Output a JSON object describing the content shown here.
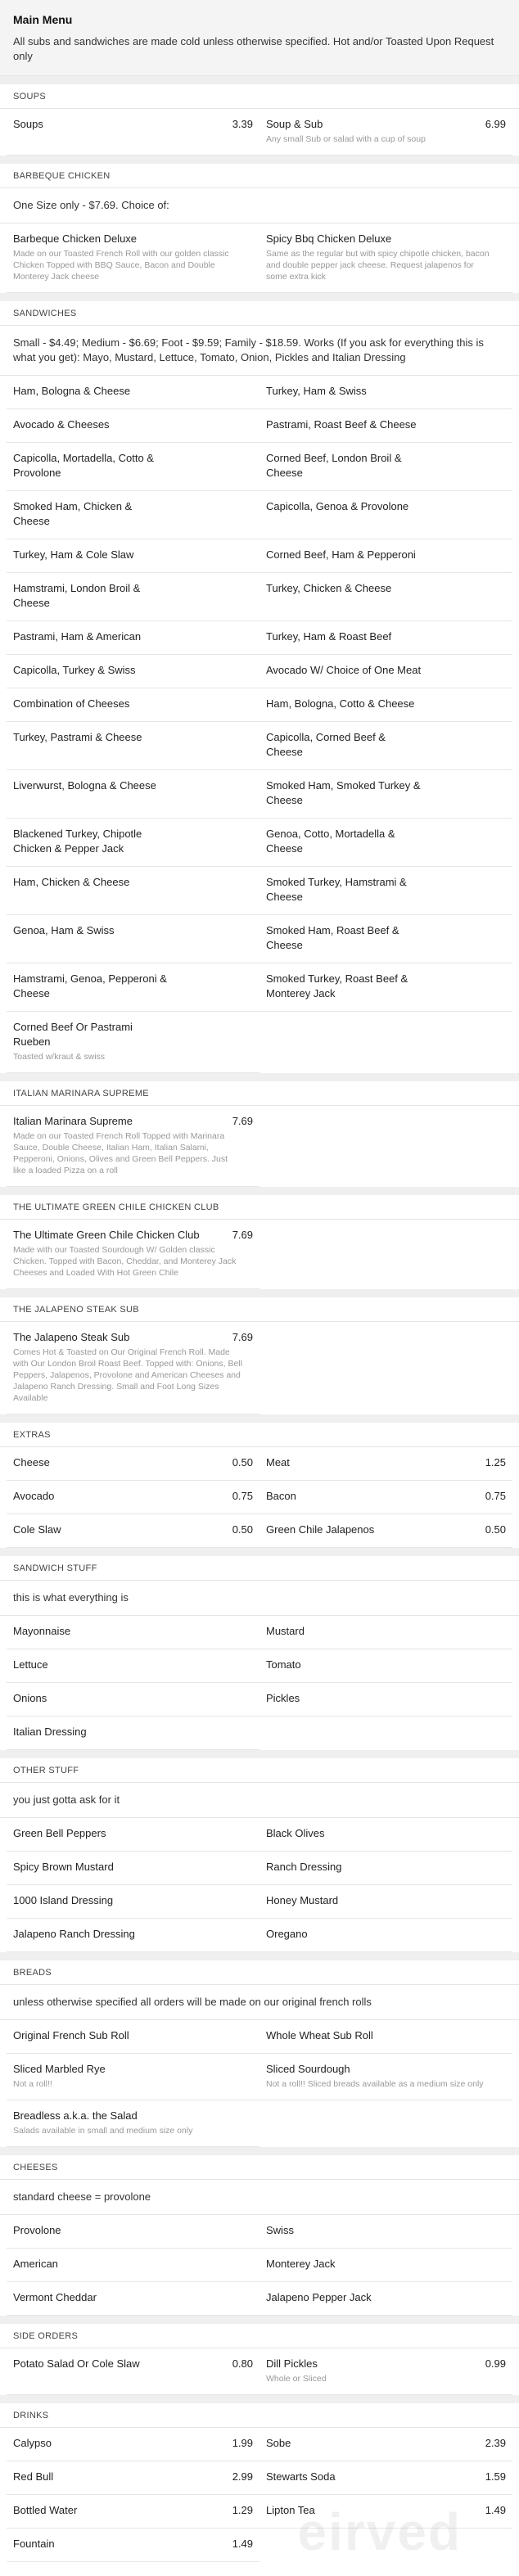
{
  "header": {
    "title": "Main Menu",
    "note": "All subs and sandwiches are made cold unless otherwise specified. Hot and/or Toasted Upon Request only"
  },
  "sections": [
    {
      "title": "SOUPS",
      "desc": "",
      "items": [
        {
          "name": "Soups",
          "price": "3.39",
          "desc": ""
        },
        {
          "name": "Soup & Sub",
          "price": "6.99",
          "desc": "Any small Sub or salad with a cup of soup"
        }
      ]
    },
    {
      "title": "BARBEQUE CHICKEN",
      "desc": "One Size only - $7.69. Choice of:",
      "items": [
        {
          "name": "Barbeque Chicken Deluxe",
          "price": "",
          "desc": "Made on our Toasted French Roll with our golden classic Chicken Topped with BBQ Sauce, Bacon and Double Monterey Jack cheese"
        },
        {
          "name": "Spicy Bbq Chicken Deluxe",
          "price": "",
          "desc": "Same as the regular but with spicy chipotle chicken, bacon and double pepper jack cheese. Request jalapenos for some extra kick"
        }
      ]
    },
    {
      "title": "SANDWICHES",
      "desc": "Small - $4.49; Medium - $6.69; Foot - $9.59; Family - $18.59. Works (If you ask for everything this is what you get): Mayo, Mustard, Lettuce, Tomato, Onion, Pickles and Italian Dressing",
      "items": [
        {
          "name": "Ham, Bologna & Cheese",
          "price": "",
          "desc": ""
        },
        {
          "name": "Turkey, Ham & Swiss",
          "price": "",
          "desc": ""
        },
        {
          "name": "Avocado & Cheeses",
          "price": "",
          "desc": ""
        },
        {
          "name": "Pastrami, Roast Beef & Cheese",
          "price": "",
          "desc": ""
        },
        {
          "name": "Capicolla, Mortadella, Cotto & Provolone",
          "price": "",
          "desc": ""
        },
        {
          "name": "Corned Beef, London Broil & Cheese",
          "price": "",
          "desc": ""
        },
        {
          "name": "Smoked Ham, Chicken & Cheese",
          "price": "",
          "desc": ""
        },
        {
          "name": "Capicolla, Genoa & Provolone",
          "price": "",
          "desc": ""
        },
        {
          "name": "Turkey, Ham & Cole Slaw",
          "price": "",
          "desc": ""
        },
        {
          "name": "Corned Beef, Ham & Pepperoni",
          "price": "",
          "desc": ""
        },
        {
          "name": "Hamstrami, London Broil & Cheese",
          "price": "",
          "desc": ""
        },
        {
          "name": "Turkey, Chicken & Cheese",
          "price": "",
          "desc": ""
        },
        {
          "name": "Pastrami, Ham & American",
          "price": "",
          "desc": ""
        },
        {
          "name": "Turkey, Ham & Roast Beef",
          "price": "",
          "desc": ""
        },
        {
          "name": "Capicolla, Turkey & Swiss",
          "price": "",
          "desc": ""
        },
        {
          "name": "Avocado W/ Choice of One Meat",
          "price": "",
          "desc": ""
        },
        {
          "name": "Combination of Cheeses",
          "price": "",
          "desc": ""
        },
        {
          "name": "Ham, Bologna, Cotto & Cheese",
          "price": "",
          "desc": ""
        },
        {
          "name": "Turkey, Pastrami & Cheese",
          "price": "",
          "desc": ""
        },
        {
          "name": "Capicolla, Corned Beef & Cheese",
          "price": "",
          "desc": ""
        },
        {
          "name": "Liverwurst, Bologna & Cheese",
          "price": "",
          "desc": ""
        },
        {
          "name": "Smoked Ham, Smoked Turkey & Cheese",
          "price": "",
          "desc": ""
        },
        {
          "name": "Blackened Turkey, Chipotle Chicken & Pepper Jack",
          "price": "",
          "desc": ""
        },
        {
          "name": "Genoa, Cotto, Mortadella & Cheese",
          "price": "",
          "desc": ""
        },
        {
          "name": "Ham, Chicken & Cheese",
          "price": "",
          "desc": ""
        },
        {
          "name": "Smoked Turkey, Hamstrami & Cheese",
          "price": "",
          "desc": ""
        },
        {
          "name": "Genoa, Ham & Swiss",
          "price": "",
          "desc": ""
        },
        {
          "name": "Smoked Ham, Roast Beef & Cheese",
          "price": "",
          "desc": ""
        },
        {
          "name": "Hamstrami, Genoa, Pepperoni & Cheese",
          "price": "",
          "desc": ""
        },
        {
          "name": "Smoked Turkey, Roast Beef & Monterey Jack",
          "price": "",
          "desc": ""
        },
        {
          "name": "Corned Beef Or Pastrami Rueben",
          "price": "",
          "desc": "Toasted w/kraut & swiss"
        }
      ]
    },
    {
      "title": "ITALIAN MARINARA SUPREME",
      "desc": "",
      "items": [
        {
          "name": "Italian Marinara Supreme",
          "price": "7.69",
          "desc": "Made on our Toasted French Roll Topped with Marinara Sauce, Double Cheese, Italian Ham, Italian Salami, Pepperoni, Onions, Olives and Green Bell Peppers. Just like a loaded Pizza on a roll"
        }
      ]
    },
    {
      "title": "THE ULTIMATE GREEN CHILE CHICKEN CLUB",
      "desc": "",
      "items": [
        {
          "name": "The Ultimate Green Chile Chicken Club",
          "price": "7.69",
          "desc": "Made with our Toasted Sourdough W/ Golden classic Chicken. Topped with Bacon, Cheddar, and Monterey Jack Cheeses and Loaded With Hot Green Chile"
        }
      ]
    },
    {
      "title": "THE JALAPENO STEAK SUB",
      "desc": "",
      "items": [
        {
          "name": "The Jalapeno Steak Sub",
          "price": "7.69",
          "desc": "Comes Hot & Toasted on Our Original French Roll. Made with Our London Broil Roast Beef. Topped with: Onions, Bell Peppers, Jalapenos, Provolone and American Cheeses and Jalapeno Ranch Dressing. Small and Foot Long Sizes Available"
        }
      ]
    },
    {
      "title": "EXTRAS",
      "desc": "",
      "items": [
        {
          "name": "Cheese",
          "price": "0.50",
          "desc": ""
        },
        {
          "name": "Meat",
          "price": "1.25",
          "desc": ""
        },
        {
          "name": "Avocado",
          "price": "0.75",
          "desc": ""
        },
        {
          "name": "Bacon",
          "price": "0.75",
          "desc": ""
        },
        {
          "name": "Cole Slaw",
          "price": "0.50",
          "desc": ""
        },
        {
          "name": "Green Chile Jalapenos",
          "price": "0.50",
          "desc": ""
        }
      ]
    },
    {
      "title": "SANDWICH STUFF",
      "desc": "this is what everything is",
      "items": [
        {
          "name": "Mayonnaise",
          "price": "",
          "desc": ""
        },
        {
          "name": "Mustard",
          "price": "",
          "desc": ""
        },
        {
          "name": "Lettuce",
          "price": "",
          "desc": ""
        },
        {
          "name": "Tomato",
          "price": "",
          "desc": ""
        },
        {
          "name": "Onions",
          "price": "",
          "desc": ""
        },
        {
          "name": "Pickles",
          "price": "",
          "desc": ""
        },
        {
          "name": "Italian Dressing",
          "price": "",
          "desc": ""
        }
      ]
    },
    {
      "title": "OTHER STUFF",
      "desc": "you just gotta ask for it",
      "items": [
        {
          "name": "Green Bell Peppers",
          "price": "",
          "desc": ""
        },
        {
          "name": "Black Olives",
          "price": "",
          "desc": ""
        },
        {
          "name": "Spicy Brown Mustard",
          "price": "",
          "desc": ""
        },
        {
          "name": "Ranch Dressing",
          "price": "",
          "desc": ""
        },
        {
          "name": "1000 Island Dressing",
          "price": "",
          "desc": ""
        },
        {
          "name": "Honey Mustard",
          "price": "",
          "desc": ""
        },
        {
          "name": "Jalapeno Ranch Dressing",
          "price": "",
          "desc": ""
        },
        {
          "name": "Oregano",
          "price": "",
          "desc": ""
        }
      ]
    },
    {
      "title": "BREADS",
      "desc": "unless otherwise specified all orders will be made on our original french rolls",
      "items": [
        {
          "name": "Original French Sub Roll",
          "price": "",
          "desc": ""
        },
        {
          "name": "Whole Wheat Sub Roll",
          "price": "",
          "desc": ""
        },
        {
          "name": "Sliced Marbled Rye",
          "price": "",
          "desc": "Not a roll!!"
        },
        {
          "name": "Sliced Sourdough",
          "price": "",
          "desc": "Not a roll!! Sliced breads available as a medium size only"
        },
        {
          "name": "Breadless a.k.a. the Salad",
          "price": "",
          "desc": "Salads available in small and medium size only"
        }
      ]
    },
    {
      "title": "CHEESES",
      "desc": "standard cheese = provolone",
      "items": [
        {
          "name": "Provolone",
          "price": "",
          "desc": ""
        },
        {
          "name": "Swiss",
          "price": "",
          "desc": ""
        },
        {
          "name": "American",
          "price": "",
          "desc": ""
        },
        {
          "name": "Monterey Jack",
          "price": "",
          "desc": ""
        },
        {
          "name": "Vermont Cheddar",
          "price": "",
          "desc": ""
        },
        {
          "name": "Jalapeno Pepper Jack",
          "price": "",
          "desc": ""
        }
      ]
    },
    {
      "title": "SIDE ORDERS",
      "desc": "",
      "items": [
        {
          "name": "Potato Salad Or Cole Slaw",
          "price": "0.80",
          "desc": ""
        },
        {
          "name": "Dill Pickles",
          "price": "0.99",
          "desc": "Whole or Sliced"
        }
      ]
    },
    {
      "title": "DRINKS",
      "desc": "",
      "items": [
        {
          "name": "Calypso",
          "price": "1.99",
          "desc": ""
        },
        {
          "name": "Sobe",
          "price": "2.39",
          "desc": ""
        },
        {
          "name": "Red Bull",
          "price": "2.99",
          "desc": ""
        },
        {
          "name": "Stewarts Soda",
          "price": "1.59",
          "desc": ""
        },
        {
          "name": "Bottled Water",
          "price": "1.29",
          "desc": ""
        },
        {
          "name": "Lipton Tea",
          "price": "1.49",
          "desc": ""
        },
        {
          "name": "Fountain",
          "price": "1.49",
          "desc": ""
        }
      ]
    }
  ],
  "watermark": "eirved"
}
